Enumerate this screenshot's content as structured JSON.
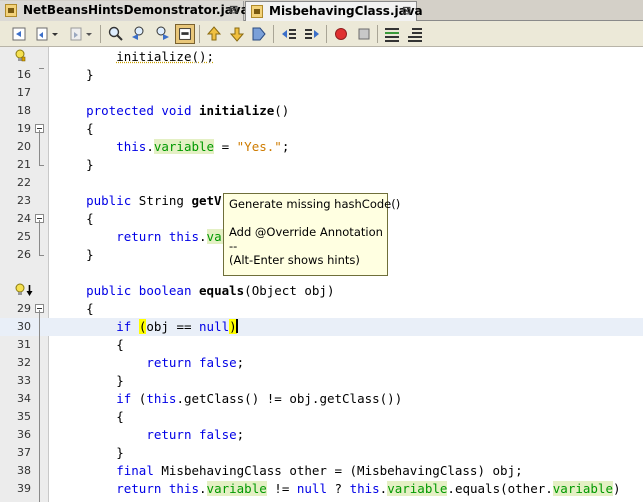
{
  "tabs": [
    {
      "label": "NetBeansHintsDemonstrator.java",
      "close": "⊠",
      "active": false
    },
    {
      "label": "MisbehavingClass.java",
      "close": "⊠",
      "active": true
    }
  ],
  "toolbar": {
    "buttons": [
      "back-icon",
      "last-edit-icon",
      "forward-icon",
      "find-icon",
      "find-previous-icon",
      "find-next-icon",
      "toggle-highlight-icon",
      "previous-bookmark-icon",
      "next-bookmark-icon",
      "toggle-bookmark-icon",
      "shift-left-icon",
      "shift-right-icon",
      "start-macro-icon",
      "stop-macro-icon",
      "comment-icon",
      "uncomment-icon"
    ]
  },
  "editor": {
    "current_line": "30",
    "lines": [
      {
        "num": "",
        "text": "initialize();"
      },
      {
        "num": "16",
        "text": "}"
      },
      {
        "num": "17",
        "text": ""
      },
      {
        "num": "18",
        "text": "protected void initialize()"
      },
      {
        "num": "19",
        "text": "{"
      },
      {
        "num": "20",
        "text": "this.variable = \"Yes.\";"
      },
      {
        "num": "21",
        "text": "}"
      },
      {
        "num": "22",
        "text": ""
      },
      {
        "num": "23",
        "text": "public String getV"
      },
      {
        "num": "24",
        "text": "{"
      },
      {
        "num": "25",
        "text": "return this.var"
      },
      {
        "num": "26",
        "text": "}"
      },
      {
        "num": "",
        "text": ""
      },
      {
        "num": "",
        "text": "public boolean equals(Object obj)"
      },
      {
        "num": "29",
        "text": "{"
      },
      {
        "num": "30",
        "text": "if (obj == null)"
      },
      {
        "num": "31",
        "text": "{"
      },
      {
        "num": "32",
        "text": "return false;"
      },
      {
        "num": "33",
        "text": "}"
      },
      {
        "num": "34",
        "text": "if (this.getClass() != obj.getClass())"
      },
      {
        "num": "35",
        "text": "{"
      },
      {
        "num": "36",
        "text": "return false;"
      },
      {
        "num": "37",
        "text": "}"
      },
      {
        "num": "38",
        "text": "final MisbehavingClass other = (MisbehavingClass) obj;"
      },
      {
        "num": "39",
        "text": "return this.variable != null ? this.variable.equals(other.variable)"
      }
    ]
  },
  "tooltip": {
    "line1": "Generate missing hashCode()",
    "line2": "",
    "line3": "Add @Override Annotation",
    "line4": "--",
    "line5": "(Alt-Enter shows hints)"
  },
  "colors": {
    "keyword": "#0000e6",
    "field": "#009900",
    "string": "#ce7b00",
    "bracket_match": "#ffff00",
    "tooltip_bg": "#ffffe1"
  }
}
